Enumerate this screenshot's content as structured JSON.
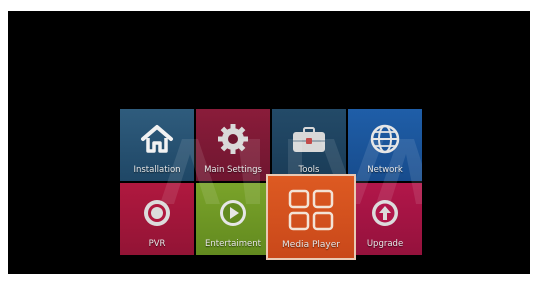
{
  "menu": {
    "brand_watermark": "ARIVA",
    "tiles": {
      "installation": {
        "label": "Installation",
        "icon": "house-icon"
      },
      "main_settings": {
        "label": "Main Settings",
        "icon": "gear-icon"
      },
      "tools": {
        "label": "Tools",
        "icon": "toolbox-icon"
      },
      "network": {
        "label": "Network",
        "icon": "globe-icon"
      },
      "pvr": {
        "label": "PVR",
        "icon": "record-icon"
      },
      "entertainment": {
        "label": "Entertaiment",
        "icon": "play-icon"
      },
      "media_player": {
        "label": "Media Player",
        "icon": "grid-icon",
        "selected": true
      },
      "upgrade": {
        "label": "Upgrade",
        "icon": "upload-arrow-icon"
      }
    }
  },
  "colors": {
    "installation": "#2f5c7d",
    "main_settings": "#8a1c3a",
    "tools": "#234a68",
    "network": "#1f5ea8",
    "pvr": "#b0183f",
    "entertainment": "#7aa32a",
    "media_player": "#dd5a22",
    "upgrade": "#b2164a"
  }
}
